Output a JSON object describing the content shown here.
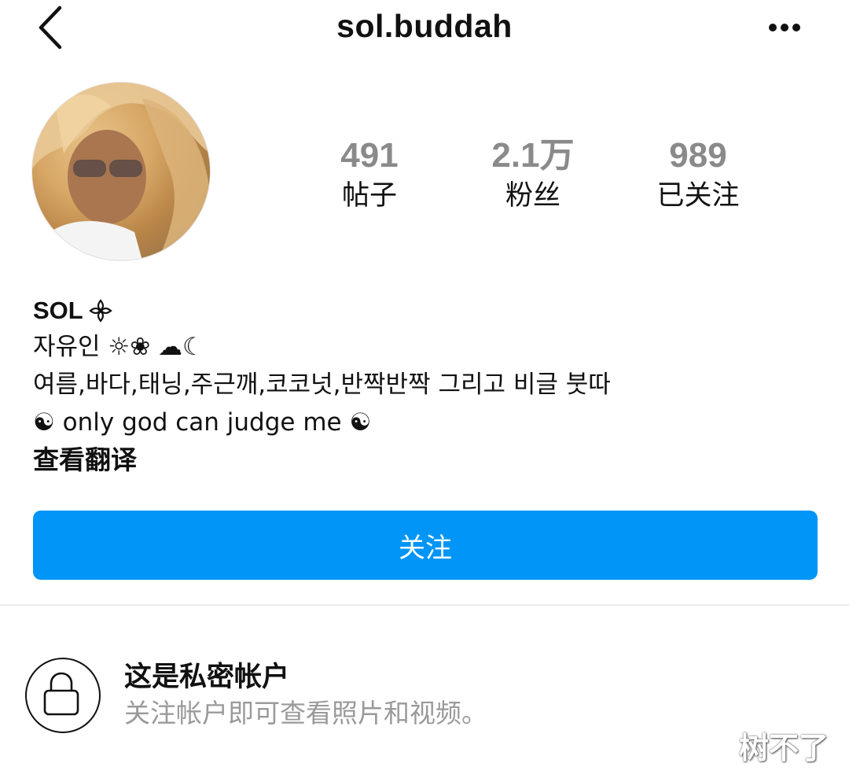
{
  "header": {
    "username": "sol.buddah",
    "back_icon": "chevron-left-icon",
    "more_icon": "more-horizontal-icon"
  },
  "profile": {
    "stats": [
      {
        "value": "491",
        "label": "帖子"
      },
      {
        "value": "2.1万",
        "label": "粉丝"
      },
      {
        "value": "989",
        "label": "已关注"
      }
    ]
  },
  "bio": {
    "name": "SOL",
    "name_symbol": "flower-outline-icon",
    "line1": "자유인 ☼❀ ☁☾",
    "line2": "여름,바다,태닝,주근깨,코코넛,반짝반짝 그리고 비글 붓따",
    "line3": "☯ only god can judge me ☯",
    "translate": "查看翻译"
  },
  "actions": {
    "follow_label": "关注",
    "follow_color": "#0095f6"
  },
  "private": {
    "title": "这是私密帐户",
    "description": "关注帐户即可查看照片和视频。",
    "icon": "lock-icon"
  },
  "watermark": "树不了"
}
